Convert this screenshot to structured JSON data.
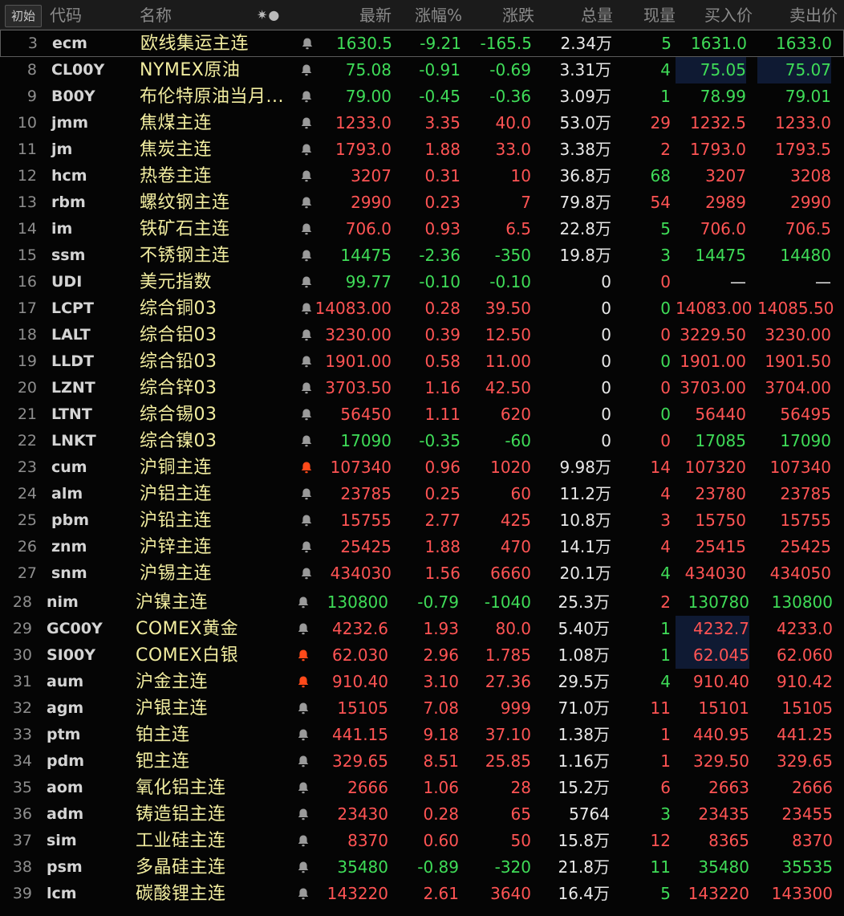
{
  "header": {
    "start_label": "初始",
    "columns": {
      "code": "代码",
      "name": "名称",
      "last": "最新",
      "change_pct": "涨幅%",
      "change": "涨跌",
      "volume": "总量",
      "cur_vol": "现量",
      "bid": "买入价",
      "ask": "卖出价"
    },
    "icon_glyph": "✷●"
  },
  "colors": {
    "up": "#ff5454",
    "down": "#3fdc58",
    "name": "#f2eda0",
    "bell_idle": "#9a9a9a",
    "bell_active": "#ff4a1a"
  },
  "rows": [
    {
      "n": "3",
      "code": "ecm",
      "name": "欧线集运主连",
      "bell": "idle",
      "last": "1630.5",
      "pct": "-9.21",
      "chg": "-165.5",
      "vol": "2.34",
      "unit": "万",
      "cv": "5",
      "bid": "1631.0",
      "ask": "1633.0",
      "dir": "down",
      "cvdir": "down",
      "biddir": "down",
      "askdir": "down"
    },
    {
      "n": "8",
      "code": "CL00Y",
      "name": "NYMEX原油",
      "bell": "idle",
      "last": "75.08",
      "pct": "-0.91",
      "chg": "-0.69",
      "vol": "3.31",
      "unit": "万",
      "cv": "4",
      "bid": "75.05",
      "ask": "75.07",
      "dir": "down",
      "cvdir": "down",
      "biddir": "down",
      "askdir": "down",
      "hl": true
    },
    {
      "n": "9",
      "code": "B00Y",
      "name": "布伦特原油当月...",
      "bell": "idle",
      "last": "79.00",
      "pct": "-0.45",
      "chg": "-0.36",
      "vol": "3.09",
      "unit": "万",
      "cv": "1",
      "bid": "78.99",
      "ask": "79.01",
      "dir": "down",
      "cvdir": "down",
      "biddir": "down",
      "askdir": "down"
    },
    {
      "n": "10",
      "code": "jmm",
      "name": "焦煤主连",
      "bell": "idle",
      "last": "1233.0",
      "pct": "3.35",
      "chg": "40.0",
      "vol": "53.0",
      "unit": "万",
      "cv": "29",
      "bid": "1232.5",
      "ask": "1233.0",
      "dir": "up",
      "cvdir": "up",
      "biddir": "up",
      "askdir": "up"
    },
    {
      "n": "11",
      "code": "jm",
      "name": "焦炭主连",
      "bell": "idle",
      "last": "1793.0",
      "pct": "1.88",
      "chg": "33.0",
      "vol": "3.38",
      "unit": "万",
      "cv": "2",
      "bid": "1793.0",
      "ask": "1793.5",
      "dir": "up",
      "cvdir": "up",
      "biddir": "up",
      "askdir": "up"
    },
    {
      "n": "12",
      "code": "hcm",
      "name": "热卷主连",
      "bell": "idle",
      "last": "3207",
      "pct": "0.31",
      "chg": "10",
      "vol": "36.8",
      "unit": "万",
      "cv": "68",
      "bid": "3207",
      "ask": "3208",
      "dir": "up",
      "cvdir": "down",
      "biddir": "up",
      "askdir": "up"
    },
    {
      "n": "13",
      "code": "rbm",
      "name": "螺纹钢主连",
      "bell": "idle",
      "last": "2990",
      "pct": "0.23",
      "chg": "7",
      "vol": "79.8",
      "unit": "万",
      "cv": "54",
      "bid": "2989",
      "ask": "2990",
      "dir": "up",
      "cvdir": "up",
      "biddir": "up",
      "askdir": "up"
    },
    {
      "n": "14",
      "code": "im",
      "name": "铁矿石主连",
      "bell": "idle",
      "last": "706.0",
      "pct": "0.93",
      "chg": "6.5",
      "vol": "22.8",
      "unit": "万",
      "cv": "5",
      "bid": "706.0",
      "ask": "706.5",
      "dir": "up",
      "cvdir": "down",
      "biddir": "up",
      "askdir": "up"
    },
    {
      "n": "15",
      "code": "ssm",
      "name": "不锈钢主连",
      "bell": "idle",
      "last": "14475",
      "pct": "-2.36",
      "chg": "-350",
      "vol": "19.8",
      "unit": "万",
      "cv": "3",
      "bid": "14475",
      "ask": "14480",
      "dir": "down",
      "cvdir": "down",
      "biddir": "down",
      "askdir": "down"
    },
    {
      "n": "16",
      "code": "UDI",
      "name": "美元指数",
      "bell": "idle",
      "last": "99.77",
      "pct": "-0.10",
      "chg": "-0.10",
      "vol": "0",
      "unit": "",
      "cv": "0",
      "bid": "—",
      "ask": "—",
      "dir": "down",
      "cvdir": "up",
      "biddir": "white",
      "askdir": "white"
    },
    {
      "n": "17",
      "code": "LCPT",
      "name": "综合铜03",
      "bell": "idle",
      "last": "14083.00",
      "pct": "0.28",
      "chg": "39.50",
      "vol": "0",
      "unit": "",
      "cv": "0",
      "bid": "14083.00",
      "ask": "14085.50",
      "dir": "up",
      "cvdir": "down",
      "biddir": "up",
      "askdir": "up"
    },
    {
      "n": "18",
      "code": "LALT",
      "name": "综合铝03",
      "bell": "idle",
      "last": "3230.00",
      "pct": "0.39",
      "chg": "12.50",
      "vol": "0",
      "unit": "",
      "cv": "0",
      "bid": "3229.50",
      "ask": "3230.00",
      "dir": "up",
      "cvdir": "up",
      "biddir": "up",
      "askdir": "up"
    },
    {
      "n": "19",
      "code": "LLDT",
      "name": "综合铅03",
      "bell": "idle",
      "last": "1901.00",
      "pct": "0.58",
      "chg": "11.00",
      "vol": "0",
      "unit": "",
      "cv": "0",
      "bid": "1901.00",
      "ask": "1901.50",
      "dir": "up",
      "cvdir": "down",
      "biddir": "up",
      "askdir": "up"
    },
    {
      "n": "20",
      "code": "LZNT",
      "name": "综合锌03",
      "bell": "idle",
      "last": "3703.50",
      "pct": "1.16",
      "chg": "42.50",
      "vol": "0",
      "unit": "",
      "cv": "0",
      "bid": "3703.00",
      "ask": "3704.00",
      "dir": "up",
      "cvdir": "up",
      "biddir": "up",
      "askdir": "up"
    },
    {
      "n": "21",
      "code": "LTNT",
      "name": "综合锡03",
      "bell": "idle",
      "last": "56450",
      "pct": "1.11",
      "chg": "620",
      "vol": "0",
      "unit": "",
      "cv": "0",
      "bid": "56440",
      "ask": "56495",
      "dir": "up",
      "cvdir": "down",
      "biddir": "up",
      "askdir": "up"
    },
    {
      "n": "22",
      "code": "LNKT",
      "name": "综合镍03",
      "bell": "idle",
      "last": "17090",
      "pct": "-0.35",
      "chg": "-60",
      "vol": "0",
      "unit": "",
      "cv": "0",
      "bid": "17085",
      "ask": "17090",
      "dir": "down",
      "cvdir": "up",
      "biddir": "down",
      "askdir": "down"
    },
    {
      "n": "23",
      "code": "cum",
      "name": "沪铜主连",
      "bell": "active",
      "last": "107340",
      "pct": "0.96",
      "chg": "1020",
      "vol": "9.98",
      "unit": "万",
      "cv": "14",
      "bid": "107320",
      "ask": "107340",
      "dir": "up",
      "cvdir": "up",
      "biddir": "up",
      "askdir": "up"
    },
    {
      "n": "24",
      "code": "alm",
      "name": "沪铝主连",
      "bell": "idle",
      "last": "23785",
      "pct": "0.25",
      "chg": "60",
      "vol": "11.2",
      "unit": "万",
      "cv": "4",
      "bid": "23780",
      "ask": "23785",
      "dir": "up",
      "cvdir": "up",
      "biddir": "up",
      "askdir": "up"
    },
    {
      "n": "25",
      "code": "pbm",
      "name": "沪铅主连",
      "bell": "idle",
      "last": "15755",
      "pct": "2.77",
      "chg": "425",
      "vol": "10.8",
      "unit": "万",
      "cv": "3",
      "bid": "15750",
      "ask": "15755",
      "dir": "up",
      "cvdir": "up",
      "biddir": "up",
      "askdir": "up"
    },
    {
      "n": "26",
      "code": "znm",
      "name": "沪锌主连",
      "bell": "idle",
      "last": "25425",
      "pct": "1.88",
      "chg": "470",
      "vol": "14.1",
      "unit": "万",
      "cv": "4",
      "bid": "25415",
      "ask": "25425",
      "dir": "up",
      "cvdir": "up",
      "biddir": "up",
      "askdir": "up"
    },
    {
      "n": "27",
      "code": "snm",
      "name": "沪锡主连",
      "bell": "idle",
      "last": "434030",
      "pct": "1.56",
      "chg": "6660",
      "vol": "20.1",
      "unit": "万",
      "cv": "4",
      "bid": "434030",
      "ask": "434050",
      "dir": "up",
      "cvdir": "down",
      "biddir": "up",
      "askdir": "up"
    }
  ],
  "rows_b": [
    {
      "n": "28",
      "code": "nim",
      "name": "沪镍主连",
      "bell": "idle",
      "last": "130800",
      "pct": "-0.79",
      "chg": "-1040",
      "vol": "25.3",
      "unit": "万",
      "cv": "2",
      "bid": "130780",
      "ask": "130800",
      "dir": "down",
      "cvdir": "up",
      "biddir": "down",
      "askdir": "down"
    },
    {
      "n": "29",
      "code": "GC00Y",
      "name": "COMEX黄金",
      "bell": "idle",
      "last": "4232.6",
      "pct": "1.93",
      "chg": "80.0",
      "vol": "5.40",
      "unit": "万",
      "cv": "1",
      "bid": "4232.7",
      "ask": "4233.0",
      "dir": "up",
      "cvdir": "down",
      "biddir": "up",
      "askdir": "up",
      "hl": true
    },
    {
      "n": "30",
      "code": "SI00Y",
      "name": "COMEX白银",
      "bell": "active",
      "last": "62.030",
      "pct": "2.96",
      "chg": "1.785",
      "vol": "1.08",
      "unit": "万",
      "cv": "1",
      "bid": "62.045",
      "ask": "62.060",
      "dir": "up",
      "cvdir": "down",
      "biddir": "up",
      "askdir": "up",
      "hl": true
    },
    {
      "n": "31",
      "code": "aum",
      "name": "沪金主连",
      "bell": "active",
      "last": "910.40",
      "pct": "3.10",
      "chg": "27.36",
      "vol": "29.5",
      "unit": "万",
      "cv": "4",
      "bid": "910.40",
      "ask": "910.42",
      "dir": "up",
      "cvdir": "down",
      "biddir": "up",
      "askdir": "up"
    },
    {
      "n": "32",
      "code": "agm",
      "name": "沪银主连",
      "bell": "idle",
      "last": "15105",
      "pct": "7.08",
      "chg": "999",
      "vol": "71.0",
      "unit": "万",
      "cv": "11",
      "bid": "15101",
      "ask": "15105",
      "dir": "up",
      "cvdir": "up",
      "biddir": "up",
      "askdir": "up"
    },
    {
      "n": "33",
      "code": "ptm",
      "name": "铂主连",
      "bell": "idle",
      "last": "441.15",
      "pct": "9.18",
      "chg": "37.10",
      "vol": "1.38",
      "unit": "万",
      "cv": "1",
      "bid": "440.95",
      "ask": "441.25",
      "dir": "up",
      "cvdir": "up",
      "biddir": "up",
      "askdir": "up"
    },
    {
      "n": "34",
      "code": "pdm",
      "name": "钯主连",
      "bell": "idle",
      "last": "329.65",
      "pct": "8.51",
      "chg": "25.85",
      "vol": "1.16",
      "unit": "万",
      "cv": "1",
      "bid": "329.50",
      "ask": "329.65",
      "dir": "up",
      "cvdir": "up",
      "biddir": "up",
      "askdir": "up"
    },
    {
      "n": "35",
      "code": "aom",
      "name": "氧化铝主连",
      "bell": "idle",
      "last": "2666",
      "pct": "1.06",
      "chg": "28",
      "vol": "15.2",
      "unit": "万",
      "cv": "6",
      "bid": "2663",
      "ask": "2666",
      "dir": "up",
      "cvdir": "up",
      "biddir": "up",
      "askdir": "up"
    },
    {
      "n": "36",
      "code": "adm",
      "name": "铸造铝主连",
      "bell": "idle",
      "last": "23430",
      "pct": "0.28",
      "chg": "65",
      "vol": "5764",
      "unit": "",
      "cv": "3",
      "bid": "23435",
      "ask": "23455",
      "dir": "up",
      "cvdir": "down",
      "biddir": "up",
      "askdir": "up"
    },
    {
      "n": "37",
      "code": "sim",
      "name": "工业硅主连",
      "bell": "idle",
      "last": "8370",
      "pct": "0.60",
      "chg": "50",
      "vol": "15.8",
      "unit": "万",
      "cv": "12",
      "bid": "8365",
      "ask": "8370",
      "dir": "up",
      "cvdir": "up",
      "biddir": "up",
      "askdir": "up"
    },
    {
      "n": "38",
      "code": "psm",
      "name": "多晶硅主连",
      "bell": "idle",
      "last": "35480",
      "pct": "-0.89",
      "chg": "-320",
      "vol": "21.8",
      "unit": "万",
      "cv": "11",
      "bid": "35480",
      "ask": "35535",
      "dir": "down",
      "cvdir": "down",
      "biddir": "down",
      "askdir": "down"
    },
    {
      "n": "39",
      "code": "lcm",
      "name": "碳酸锂主连",
      "bell": "idle",
      "last": "143220",
      "pct": "2.61",
      "chg": "3640",
      "vol": "16.4",
      "unit": "万",
      "cv": "5",
      "bid": "143220",
      "ask": "143300",
      "dir": "up",
      "cvdir": "down",
      "biddir": "up",
      "askdir": "up"
    }
  ]
}
